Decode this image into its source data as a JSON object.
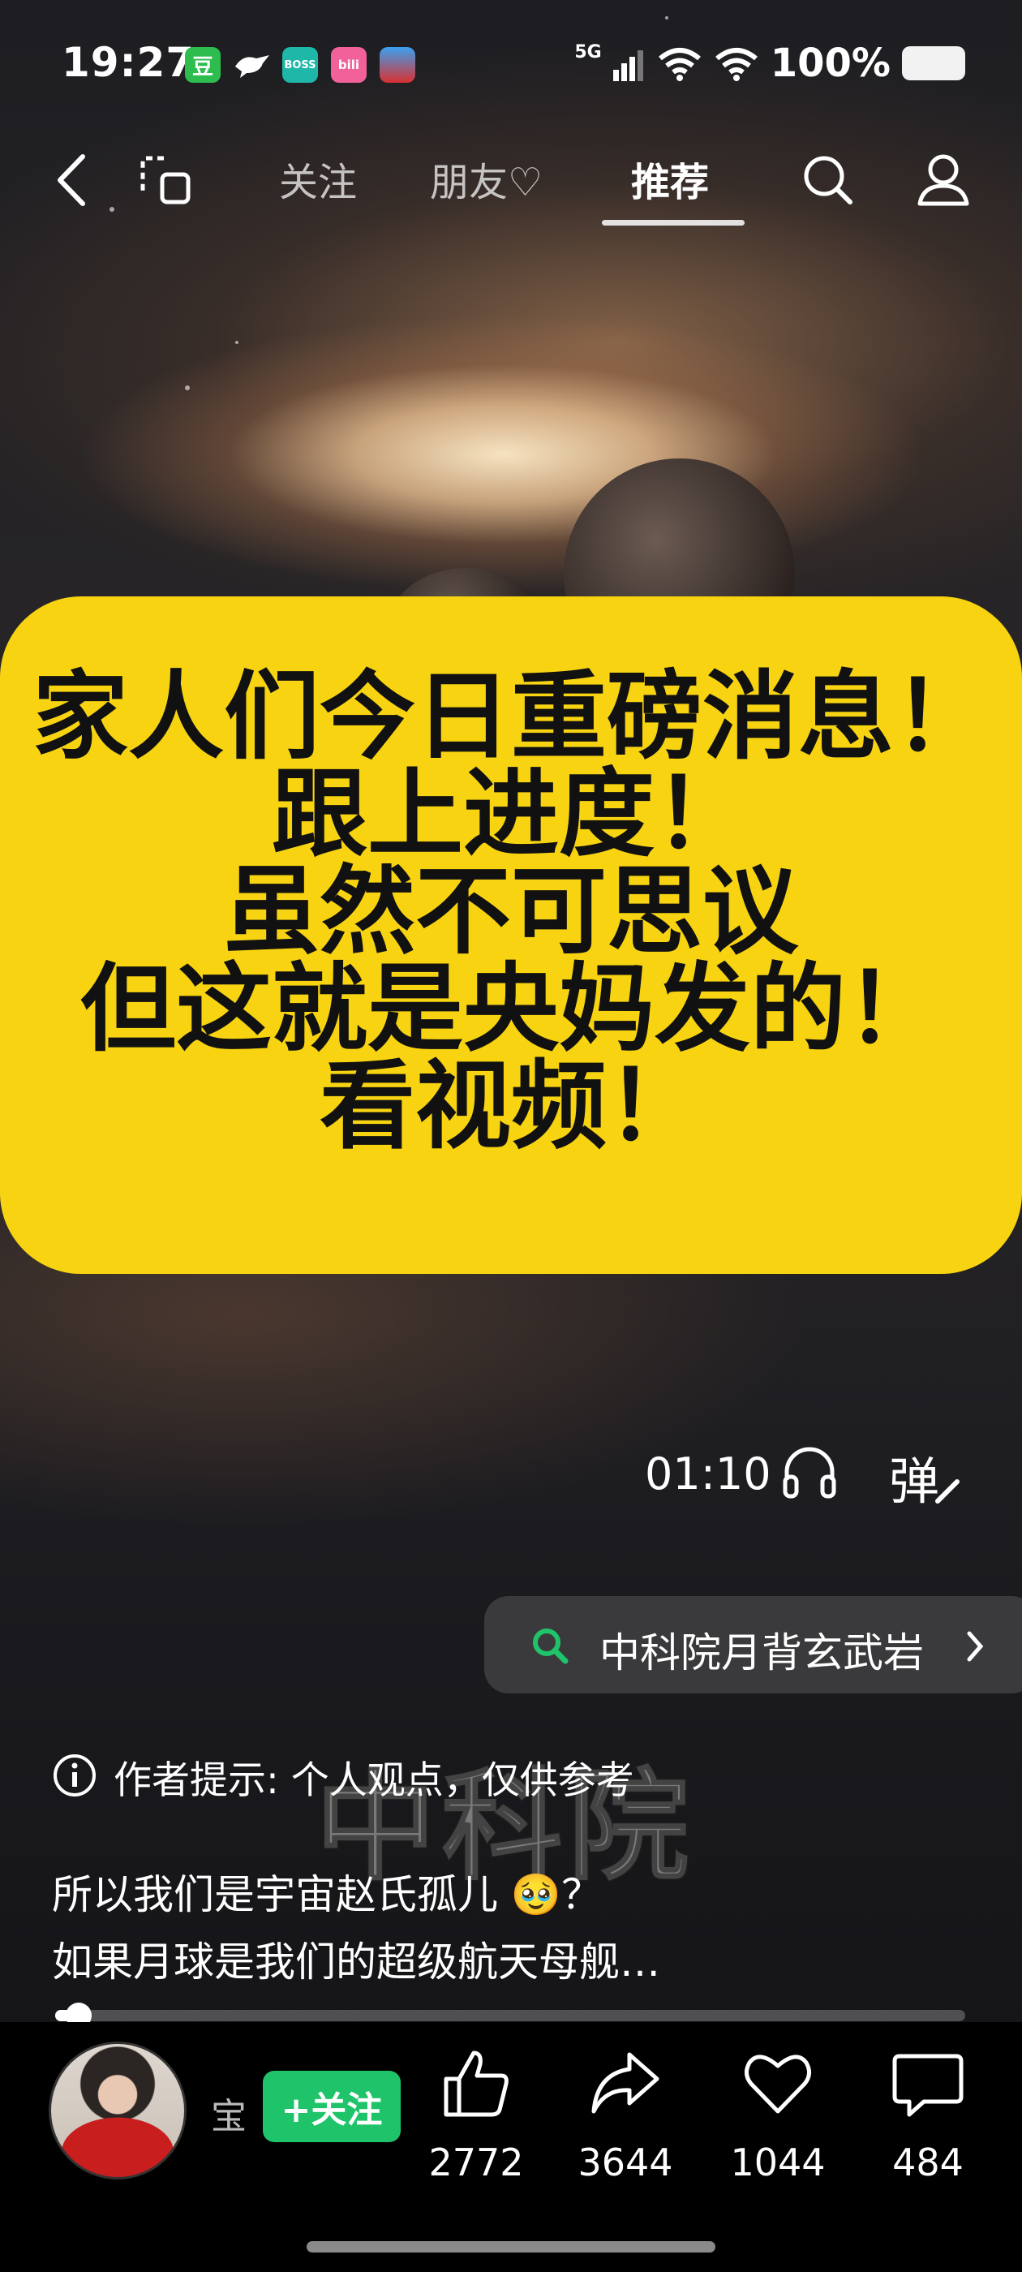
{
  "status_bar": {
    "time": "19:27",
    "app_badges": [
      {
        "name": "douban-app-icon",
        "label": "豆",
        "color": "#2dbd4e"
      },
      {
        "name": "boss-app-icon",
        "label": "BOSS",
        "color": "#1fb8a8"
      },
      {
        "name": "bilibili-app-icon",
        "label": "bili",
        "color": "#f2629a"
      }
    ],
    "network": "5G",
    "battery_percent": "100%"
  },
  "top_nav": {
    "tabs": [
      {
        "label": "关注",
        "active": false
      },
      {
        "label": "朋友♡",
        "active": false
      },
      {
        "label": "推荐",
        "active": true
      }
    ]
  },
  "banner": {
    "lines": [
      "家人们今日重磅消息！",
      "跟上进度！",
      "虽然不可思议",
      "但这就是央妈发的！",
      "看视频！"
    ],
    "color": "#f7d311"
  },
  "video": {
    "duration": "01:10",
    "danmu_label": "弹",
    "progress": 0.026
  },
  "search_suggestion": {
    "text": "中科院月背玄武岩",
    "accent": "#1fc36a"
  },
  "author_tip": "作者提示: 个人观点，仅供参考",
  "watermark": "中科院",
  "caption": {
    "line1": "所以我们是宇宙赵氏孤儿 🥹？",
    "line2": "如果月球是我们的超级航天母舰…"
  },
  "author": {
    "name_partial": "宝",
    "follow_label": "+关注"
  },
  "actions": [
    {
      "name": "like",
      "count": "2772"
    },
    {
      "name": "share",
      "count": "3644"
    },
    {
      "name": "favorite",
      "count": "1044"
    },
    {
      "name": "comment",
      "count": "484"
    }
  ]
}
